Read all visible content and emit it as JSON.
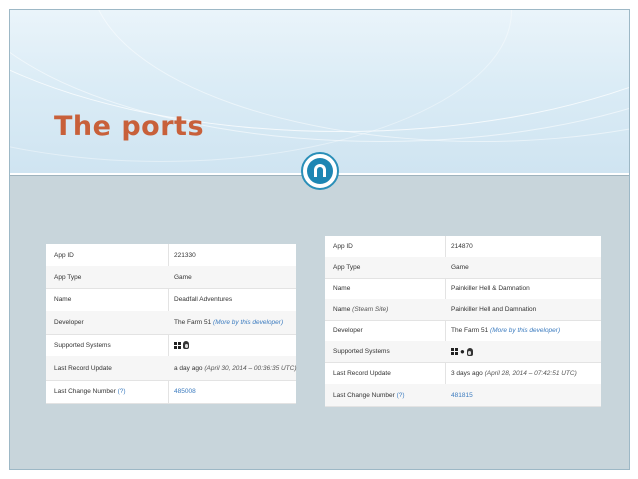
{
  "slide": {
    "title": "The ports",
    "accent_color": "#c8603a",
    "logo_icon": "n-logo-icon"
  },
  "panel1": {
    "rows": [
      {
        "key": "App ID",
        "value": "221330"
      },
      {
        "key": "App Type",
        "value": "Game"
      },
      {
        "key": "Name",
        "value": "Deadfall Adventures"
      },
      {
        "key": "Developer",
        "value": "The Farm 51",
        "link": "(More by this developer)"
      },
      {
        "key": "Supported Systems",
        "icons": [
          "windows-icon",
          "linux-icon"
        ]
      },
      {
        "key": "Last Record Update",
        "value": "a day ago",
        "italic": "(April 30, 2014 – 00:36:35 UTC)"
      },
      {
        "key": "Last Change Number",
        "help": "(?)",
        "link": "485008"
      }
    ]
  },
  "panel2": {
    "rows": [
      {
        "key": "App ID",
        "value": "214870"
      },
      {
        "key": "App Type",
        "value": "Game"
      },
      {
        "key": "Name",
        "value": "Painkiller Hell & Damnation"
      },
      {
        "key": "Name",
        "key_italic": "(Steam Site)",
        "value": "Painkiller Hell and Damnation"
      },
      {
        "key": "Developer",
        "value": "The Farm 51",
        "link": "(More by this developer)"
      },
      {
        "key": "Supported Systems",
        "icons": [
          "windows-icon",
          "apple-icon",
          "linux-icon"
        ]
      },
      {
        "key": "Last Record Update",
        "value": "3 days ago",
        "italic": "(April 28, 2014 – 07:42:51 UTC)"
      },
      {
        "key": "Last Change Number",
        "help": "(?)",
        "link": "481815"
      }
    ]
  }
}
